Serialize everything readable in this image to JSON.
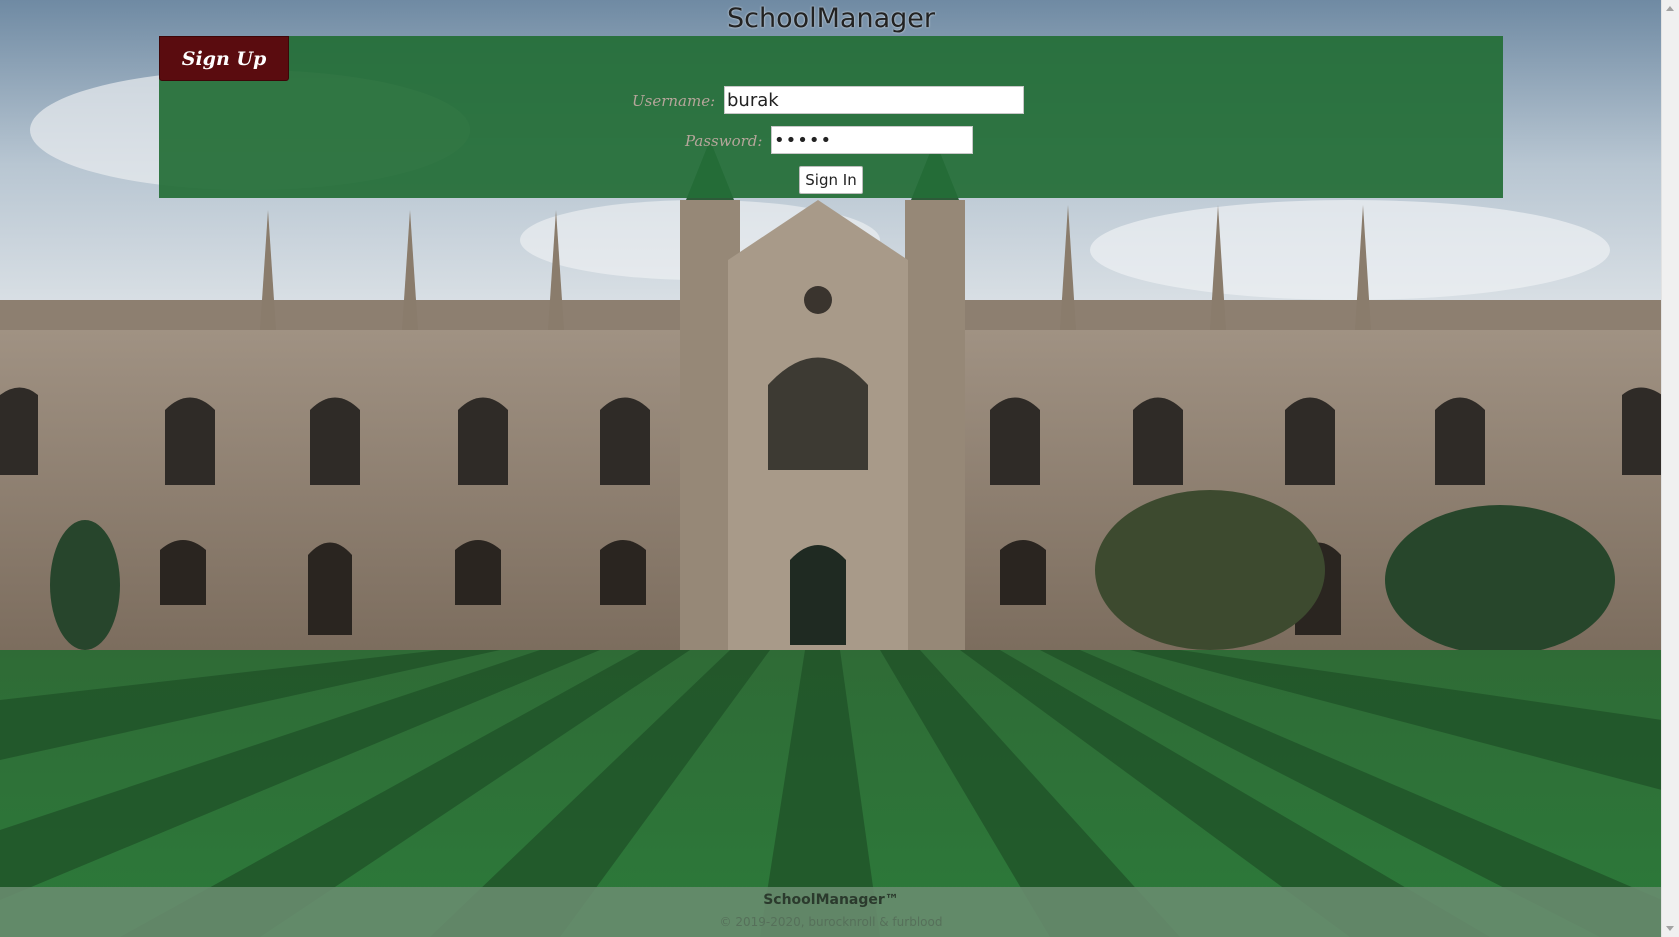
{
  "header": {
    "title": "SchoolManager"
  },
  "auth": {
    "signup_label": "Sign Up",
    "username_label": "Username:",
    "username_value": "burak",
    "password_label": "Password:",
    "password_value": "burak",
    "signin_label": "Sign In"
  },
  "footer": {
    "brand": "SchoolManager™",
    "copyright": "© 2019-2020, burocknroll & furblood"
  },
  "background": {
    "icon": "university-building-photo"
  },
  "colors": {
    "panel": "#246e37",
    "signup_button": "#5a0c0f",
    "label_text": "#b5a59a",
    "footer": "#6a8c70"
  }
}
